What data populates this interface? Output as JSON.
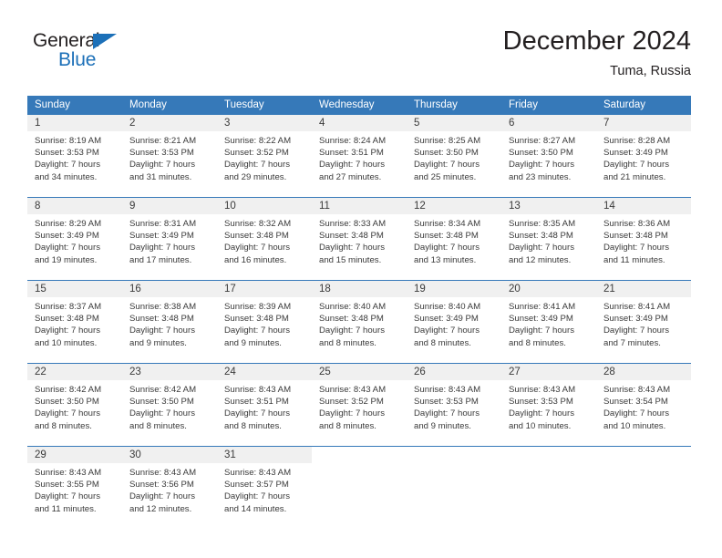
{
  "logo": {
    "word_one": "General",
    "word_two": "Blue",
    "triangle_color": "#1c70b8"
  },
  "header": {
    "title": "December 2024",
    "location": "Tuma, Russia",
    "accent_color": "#3679b9",
    "daynum_band_color": "#f0f0f0"
  },
  "weekdays": [
    "Sunday",
    "Monday",
    "Tuesday",
    "Wednesday",
    "Thursday",
    "Friday",
    "Saturday"
  ],
  "labels": {
    "sunrise_prefix": "Sunrise:",
    "sunset_prefix": "Sunset:",
    "daylight_prefix": "Daylight:"
  },
  "weeks": [
    [
      {
        "day": "1",
        "sunrise": "Sunrise: 8:19 AM",
        "sunset": "Sunset: 3:53 PM",
        "daylight_line1": "Daylight: 7 hours",
        "daylight_line2": "and 34 minutes."
      },
      {
        "day": "2",
        "sunrise": "Sunrise: 8:21 AM",
        "sunset": "Sunset: 3:53 PM",
        "daylight_line1": "Daylight: 7 hours",
        "daylight_line2": "and 31 minutes."
      },
      {
        "day": "3",
        "sunrise": "Sunrise: 8:22 AM",
        "sunset": "Sunset: 3:52 PM",
        "daylight_line1": "Daylight: 7 hours",
        "daylight_line2": "and 29 minutes."
      },
      {
        "day": "4",
        "sunrise": "Sunrise: 8:24 AM",
        "sunset": "Sunset: 3:51 PM",
        "daylight_line1": "Daylight: 7 hours",
        "daylight_line2": "and 27 minutes."
      },
      {
        "day": "5",
        "sunrise": "Sunrise: 8:25 AM",
        "sunset": "Sunset: 3:50 PM",
        "daylight_line1": "Daylight: 7 hours",
        "daylight_line2": "and 25 minutes."
      },
      {
        "day": "6",
        "sunrise": "Sunrise: 8:27 AM",
        "sunset": "Sunset: 3:50 PM",
        "daylight_line1": "Daylight: 7 hours",
        "daylight_line2": "and 23 minutes."
      },
      {
        "day": "7",
        "sunrise": "Sunrise: 8:28 AM",
        "sunset": "Sunset: 3:49 PM",
        "daylight_line1": "Daylight: 7 hours",
        "daylight_line2": "and 21 minutes."
      }
    ],
    [
      {
        "day": "8",
        "sunrise": "Sunrise: 8:29 AM",
        "sunset": "Sunset: 3:49 PM",
        "daylight_line1": "Daylight: 7 hours",
        "daylight_line2": "and 19 minutes."
      },
      {
        "day": "9",
        "sunrise": "Sunrise: 8:31 AM",
        "sunset": "Sunset: 3:49 PM",
        "daylight_line1": "Daylight: 7 hours",
        "daylight_line2": "and 17 minutes."
      },
      {
        "day": "10",
        "sunrise": "Sunrise: 8:32 AM",
        "sunset": "Sunset: 3:48 PM",
        "daylight_line1": "Daylight: 7 hours",
        "daylight_line2": "and 16 minutes."
      },
      {
        "day": "11",
        "sunrise": "Sunrise: 8:33 AM",
        "sunset": "Sunset: 3:48 PM",
        "daylight_line1": "Daylight: 7 hours",
        "daylight_line2": "and 15 minutes."
      },
      {
        "day": "12",
        "sunrise": "Sunrise: 8:34 AM",
        "sunset": "Sunset: 3:48 PM",
        "daylight_line1": "Daylight: 7 hours",
        "daylight_line2": "and 13 minutes."
      },
      {
        "day": "13",
        "sunrise": "Sunrise: 8:35 AM",
        "sunset": "Sunset: 3:48 PM",
        "daylight_line1": "Daylight: 7 hours",
        "daylight_line2": "and 12 minutes."
      },
      {
        "day": "14",
        "sunrise": "Sunrise: 8:36 AM",
        "sunset": "Sunset: 3:48 PM",
        "daylight_line1": "Daylight: 7 hours",
        "daylight_line2": "and 11 minutes."
      }
    ],
    [
      {
        "day": "15",
        "sunrise": "Sunrise: 8:37 AM",
        "sunset": "Sunset: 3:48 PM",
        "daylight_line1": "Daylight: 7 hours",
        "daylight_line2": "and 10 minutes."
      },
      {
        "day": "16",
        "sunrise": "Sunrise: 8:38 AM",
        "sunset": "Sunset: 3:48 PM",
        "daylight_line1": "Daylight: 7 hours",
        "daylight_line2": "and 9 minutes."
      },
      {
        "day": "17",
        "sunrise": "Sunrise: 8:39 AM",
        "sunset": "Sunset: 3:48 PM",
        "daylight_line1": "Daylight: 7 hours",
        "daylight_line2": "and 9 minutes."
      },
      {
        "day": "18",
        "sunrise": "Sunrise: 8:40 AM",
        "sunset": "Sunset: 3:48 PM",
        "daylight_line1": "Daylight: 7 hours",
        "daylight_line2": "and 8 minutes."
      },
      {
        "day": "19",
        "sunrise": "Sunrise: 8:40 AM",
        "sunset": "Sunset: 3:49 PM",
        "daylight_line1": "Daylight: 7 hours",
        "daylight_line2": "and 8 minutes."
      },
      {
        "day": "20",
        "sunrise": "Sunrise: 8:41 AM",
        "sunset": "Sunset: 3:49 PM",
        "daylight_line1": "Daylight: 7 hours",
        "daylight_line2": "and 8 minutes."
      },
      {
        "day": "21",
        "sunrise": "Sunrise: 8:41 AM",
        "sunset": "Sunset: 3:49 PM",
        "daylight_line1": "Daylight: 7 hours",
        "daylight_line2": "and 7 minutes."
      }
    ],
    [
      {
        "day": "22",
        "sunrise": "Sunrise: 8:42 AM",
        "sunset": "Sunset: 3:50 PM",
        "daylight_line1": "Daylight: 7 hours",
        "daylight_line2": "and 8 minutes."
      },
      {
        "day": "23",
        "sunrise": "Sunrise: 8:42 AM",
        "sunset": "Sunset: 3:50 PM",
        "daylight_line1": "Daylight: 7 hours",
        "daylight_line2": "and 8 minutes."
      },
      {
        "day": "24",
        "sunrise": "Sunrise: 8:43 AM",
        "sunset": "Sunset: 3:51 PM",
        "daylight_line1": "Daylight: 7 hours",
        "daylight_line2": "and 8 minutes."
      },
      {
        "day": "25",
        "sunrise": "Sunrise: 8:43 AM",
        "sunset": "Sunset: 3:52 PM",
        "daylight_line1": "Daylight: 7 hours",
        "daylight_line2": "and 8 minutes."
      },
      {
        "day": "26",
        "sunrise": "Sunrise: 8:43 AM",
        "sunset": "Sunset: 3:53 PM",
        "daylight_line1": "Daylight: 7 hours",
        "daylight_line2": "and 9 minutes."
      },
      {
        "day": "27",
        "sunrise": "Sunrise: 8:43 AM",
        "sunset": "Sunset: 3:53 PM",
        "daylight_line1": "Daylight: 7 hours",
        "daylight_line2": "and 10 minutes."
      },
      {
        "day": "28",
        "sunrise": "Sunrise: 8:43 AM",
        "sunset": "Sunset: 3:54 PM",
        "daylight_line1": "Daylight: 7 hours",
        "daylight_line2": "and 10 minutes."
      }
    ],
    [
      {
        "day": "29",
        "sunrise": "Sunrise: 8:43 AM",
        "sunset": "Sunset: 3:55 PM",
        "daylight_line1": "Daylight: 7 hours",
        "daylight_line2": "and 11 minutes."
      },
      {
        "day": "30",
        "sunrise": "Sunrise: 8:43 AM",
        "sunset": "Sunset: 3:56 PM",
        "daylight_line1": "Daylight: 7 hours",
        "daylight_line2": "and 12 minutes."
      },
      {
        "day": "31",
        "sunrise": "Sunrise: 8:43 AM",
        "sunset": "Sunset: 3:57 PM",
        "daylight_line1": "Daylight: 7 hours",
        "daylight_line2": "and 14 minutes."
      },
      {
        "day": "",
        "sunrise": "",
        "sunset": "",
        "daylight_line1": "",
        "daylight_line2": ""
      },
      {
        "day": "",
        "sunrise": "",
        "sunset": "",
        "daylight_line1": "",
        "daylight_line2": ""
      },
      {
        "day": "",
        "sunrise": "",
        "sunset": "",
        "daylight_line1": "",
        "daylight_line2": ""
      },
      {
        "day": "",
        "sunrise": "",
        "sunset": "",
        "daylight_line1": "",
        "daylight_line2": ""
      }
    ]
  ]
}
